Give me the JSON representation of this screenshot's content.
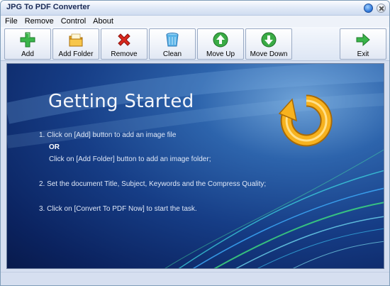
{
  "window": {
    "title": "JPG To PDF Converter"
  },
  "menu": [
    "File",
    "Remove",
    "Control",
    "About"
  ],
  "toolbar": {
    "add": "Add",
    "add_folder": "Add Folder",
    "remove": "Remove",
    "clean": "Clean",
    "move_up": "Move Up",
    "move_down": "Move Down",
    "exit": "Exit"
  },
  "content": {
    "title": "Getting Started",
    "step1": "1. Click on [Add] button to add an image file",
    "or": "OR",
    "step1b": "Click on [Add Folder] button to add an image folder;",
    "step2": "2. Set the document Title, Subject, Keywords and the Compress Quality;",
    "step3": "3. Click on [Convert To PDF Now] to start the task."
  },
  "icons": {
    "add": "plus-icon",
    "add_folder": "folder-icon",
    "remove": "red-x-icon",
    "clean": "bin-icon",
    "move_up": "arrow-up-icon",
    "move_down": "arrow-down-icon",
    "exit": "exit-arrow-icon",
    "content": "reload-icon",
    "help": "help-icon",
    "close": "close-icon"
  },
  "colors": {
    "accent": "#2a73d8",
    "content_bg": "#163d86",
    "reload": "#f7b21e",
    "add_green": "#3ab54a",
    "remove_red": "#d9281e"
  }
}
